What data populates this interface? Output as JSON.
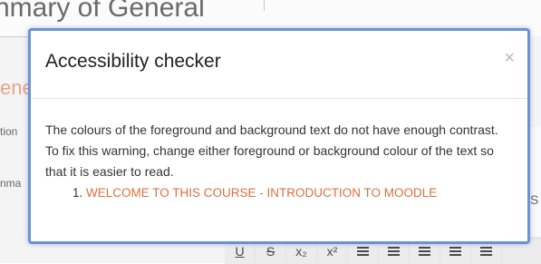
{
  "background": {
    "page_title": "nmary of General",
    "fragment_red": "ene",
    "fragment_1": "tion",
    "fragment_2": "nma",
    "edge_glyph": "S",
    "toolbar": [
      "U",
      "S",
      "x₂",
      "x²"
    ]
  },
  "modal": {
    "title": "Accessibility checker",
    "close_label": "×",
    "message": "The colours of the foreground and background text do not have enough contrast. To fix this warning, change either foreground or background colour of the text so that it is easier to read.",
    "issues": [
      "WELCOME TO THIS COURSE - INTRODUCTION TO MOODLE"
    ]
  },
  "colors": {
    "accent_border": "#6b92d4",
    "issue_text": "#d9703f"
  }
}
